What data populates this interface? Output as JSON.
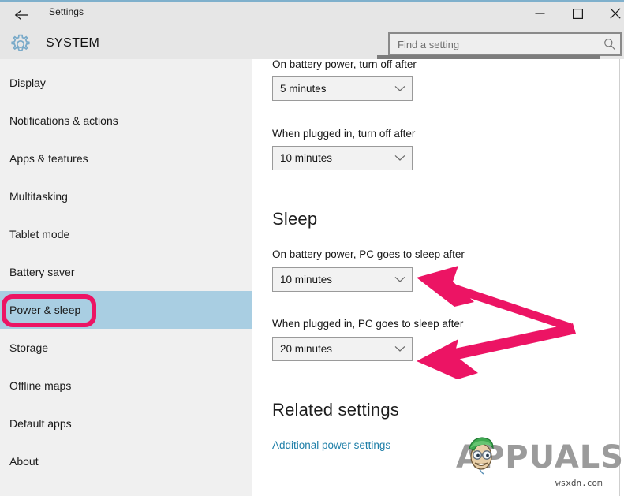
{
  "window": {
    "title": "Settings",
    "back_icon": "back-arrow-icon",
    "controls": {
      "minimize": "minimize-icon",
      "maximize": "maximize-icon",
      "close": "close-icon"
    }
  },
  "header": {
    "icon": "gear-icon",
    "title": "SYSTEM",
    "search": {
      "placeholder": "Find a setting",
      "value": "",
      "icon": "search-icon"
    }
  },
  "sidebar": {
    "items": [
      {
        "label": "Display",
        "selected": false
      },
      {
        "label": "Notifications & actions",
        "selected": false
      },
      {
        "label": "Apps & features",
        "selected": false
      },
      {
        "label": "Multitasking",
        "selected": false
      },
      {
        "label": "Tablet mode",
        "selected": false
      },
      {
        "label": "Battery saver",
        "selected": false
      },
      {
        "label": "Power & sleep",
        "selected": true
      },
      {
        "label": "Storage",
        "selected": false
      },
      {
        "label": "Offline maps",
        "selected": false
      },
      {
        "label": "Default apps",
        "selected": false
      },
      {
        "label": "About",
        "selected": false
      }
    ]
  },
  "content": {
    "screen": {
      "battery_label": "On battery power, turn off after",
      "battery_value": "5 minutes",
      "plugged_label": "When plugged in, turn off after",
      "plugged_value": "10 minutes"
    },
    "sleep": {
      "heading": "Sleep",
      "battery_label": "On battery power, PC goes to sleep after",
      "battery_value": "10 minutes",
      "plugged_label": "When plugged in, PC goes to sleep after",
      "plugged_value": "20 minutes"
    },
    "related": {
      "heading": "Related settings",
      "link": "Additional power settings"
    },
    "dropdown_icon": "chevron-down-icon"
  },
  "annotations": {
    "highlight_color": "#ec1464",
    "selected_row_color": "#a9cee2",
    "box_target": "Power & sleep",
    "arrow_targets": [
      "On battery power, PC goes to sleep after",
      "When plugged in, PC goes to sleep after"
    ]
  },
  "watermark": {
    "brand": "APPUALS",
    "site": "wsxdn.com"
  }
}
